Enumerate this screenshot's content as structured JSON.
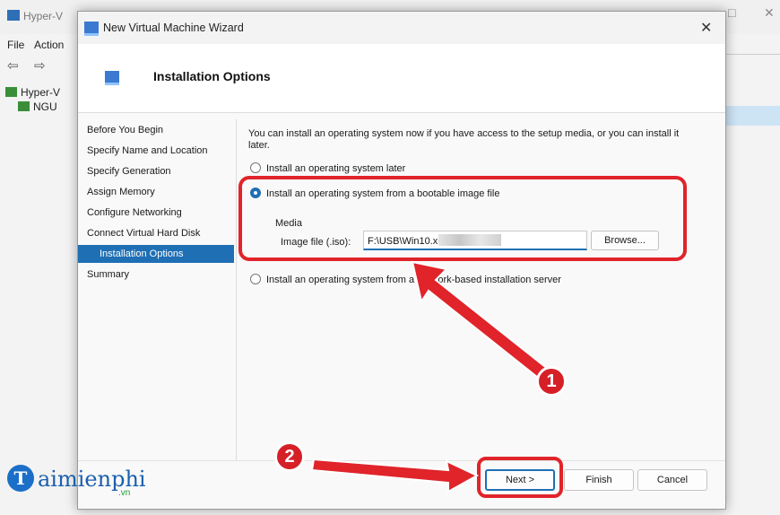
{
  "background_app": {
    "title": "Hyper-V",
    "menu": [
      "File",
      "Action"
    ],
    "tree": [
      "Hyper-V",
      "NGU"
    ],
    "caption_buttons": [
      "□",
      "✕"
    ]
  },
  "dialog": {
    "title": "New Virtual Machine Wizard",
    "close_glyph": "✕",
    "page_title": "Installation Options"
  },
  "nav": {
    "items": [
      {
        "label": "Before You Begin"
      },
      {
        "label": "Specify Name and Location"
      },
      {
        "label": "Specify Generation"
      },
      {
        "label": "Assign Memory"
      },
      {
        "label": "Configure Networking"
      },
      {
        "label": "Connect Virtual Hard Disk"
      },
      {
        "label": "Installation Options"
      },
      {
        "label": "Summary"
      }
    ],
    "selected_index": 6
  },
  "content": {
    "intro": "You can install an operating system now if you have access to the setup media, or you can install it later.",
    "options": [
      {
        "label": "Install an operating system later",
        "selected": false
      },
      {
        "label": "Install an operating system from a bootable image file",
        "selected": true
      },
      {
        "label": "Install an operating system from a network-based installation server",
        "selected": false
      }
    ],
    "media_label": "Media",
    "image_file_label": "Image file (.iso):",
    "image_file_value": "F:\\USB\\Win10.x64               .iso",
    "browse_label": "Browse..."
  },
  "buttons": {
    "next": "Next >",
    "finish": "Finish",
    "cancel": "Cancel"
  },
  "annotations": {
    "badge_1": "1",
    "badge_2": "2",
    "accent_color": "#e0242a"
  },
  "watermark": {
    "letter": "T",
    "word": "aimienphi",
    "suffix": ".vn"
  }
}
